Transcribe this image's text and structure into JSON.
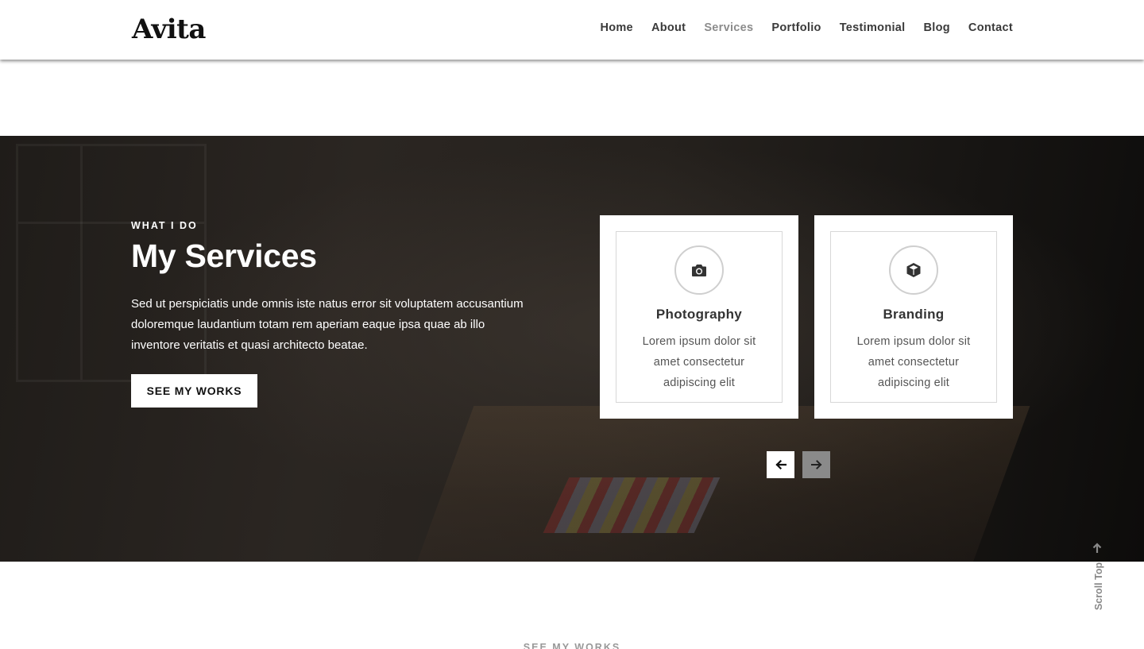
{
  "header": {
    "logo": "Avita",
    "nav": [
      "Home",
      "About",
      "Services",
      "Portfolio",
      "Testimonial",
      "Blog",
      "Contact"
    ],
    "active_nav": "Services"
  },
  "hero": {
    "subtitle": "WHAT I DO",
    "title": "My Services",
    "text": "Sed ut perspiciatis unde omnis iste natus error sit voluptatem accusantium doloremque laudantium totam rem aperiam eaque ipsa quae ab illo inventore veritatis et quasi architecto beatae.",
    "button": "SEE MY WORKS"
  },
  "services": [
    {
      "icon": "camera-icon",
      "title": "Photography",
      "text": "Lorem ipsum dolor sit amet consectetur adipiscing elit"
    },
    {
      "icon": "cube-icon",
      "title": "Branding",
      "text": "Lorem ipsum dolor sit amet consectetur adipiscing elit"
    }
  ],
  "carousel": {
    "prev_icon": "arrow-left-icon",
    "next_icon": "arrow-right-icon"
  },
  "scroll_top": {
    "label": "Scroll Top"
  },
  "next_section": {
    "subtitle": "SEE MY WORKS"
  },
  "colors": {
    "active_nav": "#8c8c8c",
    "text_dark": "#3a3a3a",
    "hero_bg": "#25211d"
  }
}
